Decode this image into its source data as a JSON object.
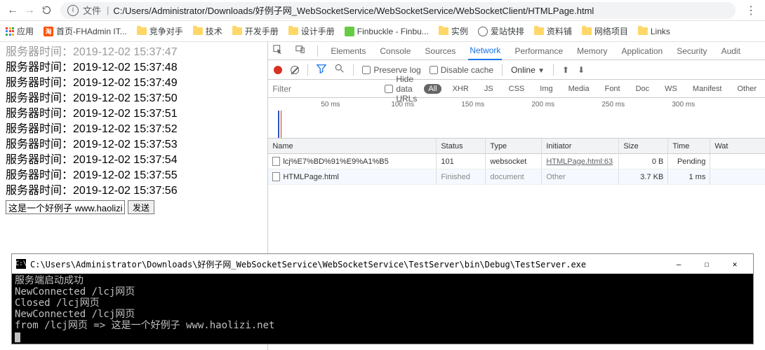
{
  "browser": {
    "file_label": "文件",
    "path": "C:/Users/Administrator/Downloads/好例子网_WebSocketService/WebSocketService/WebSocketClient/HTMLPage.html"
  },
  "bookmarks": {
    "apps": "应用",
    "items": [
      "首页-FHAdmin IT...",
      "竞争对手",
      "技术",
      "开发手册",
      "设计手册",
      "Finbuckle - Finbu...",
      "实例",
      "爱站快排",
      "资料铺",
      "网络项目",
      "Links"
    ]
  },
  "page": {
    "label_prefix": "服务器时间：",
    "lines": [
      "2019-12-02 15:37:47",
      "2019-12-02 15:37:48",
      "2019-12-02 15:37:49",
      "2019-12-02 15:37:50",
      "2019-12-02 15:37:51",
      "2019-12-02 15:37:52",
      "2019-12-02 15:37:53",
      "2019-12-02 15:37:54",
      "2019-12-02 15:37:55",
      "2019-12-02 15:37:56"
    ],
    "input_value": "这是一个好例子 www.haolizi.n",
    "send": "发送"
  },
  "devtools": {
    "tabs": [
      "Elements",
      "Console",
      "Sources",
      "Network",
      "Performance",
      "Memory",
      "Application",
      "Security",
      "Audit"
    ],
    "active_tab": "Network",
    "toolbar": {
      "preserve": "Preserve log",
      "disable": "Disable cache",
      "online": "Online"
    },
    "filter": {
      "placeholder": "Filter",
      "hide": "Hide data URLs",
      "types": [
        "All",
        "XHR",
        "JS",
        "CSS",
        "Img",
        "Media",
        "Font",
        "Doc",
        "WS",
        "Manifest",
        "Other"
      ]
    },
    "timeline_ticks": [
      "50 ms",
      "100 ms",
      "150 ms",
      "200 ms",
      "250 ms",
      "300 ms"
    ],
    "columns": [
      "Name",
      "Status",
      "Type",
      "Initiator",
      "Size",
      "Time",
      "Wat"
    ],
    "rows": [
      {
        "name": "lcj%E7%BD%91%E9%A1%B5",
        "status": "101",
        "type": "websocket",
        "initiator": "HTMLPage.html:63",
        "initiator_link": true,
        "size": "0 B",
        "time": "Pending"
      },
      {
        "name": "HTMLPage.html",
        "status": "Finished",
        "status_gray": true,
        "type": "document",
        "type_gray": true,
        "initiator": "Other",
        "initiator_gray": true,
        "size": "3.7 KB",
        "time": "1 ms"
      }
    ]
  },
  "console": {
    "title": "C:\\Users\\Administrator\\Downloads\\好例子网_WebSocketService\\WebSocketService\\TestServer\\bin\\Debug\\TestServer.exe",
    "lines": [
      "服务端启动成功",
      "NewConnected /lcj网页",
      "Closed /lcj网页",
      "NewConnected /lcj网页",
      "from /lcj网页 => 这是一个好例子 www.haolizi.net"
    ]
  }
}
